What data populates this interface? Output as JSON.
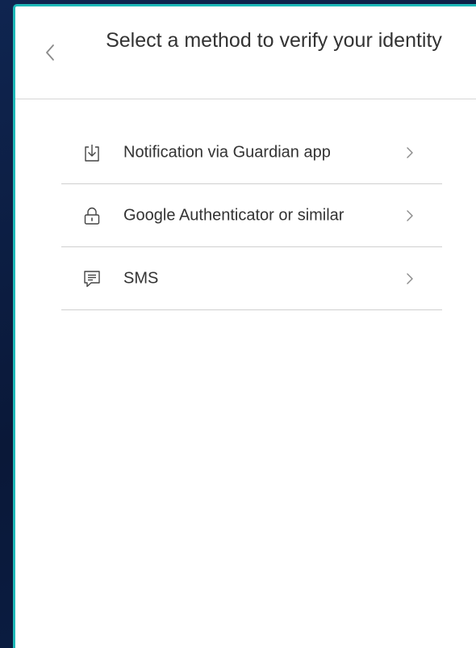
{
  "header": {
    "title": "Select a method to verify your identity"
  },
  "methods": [
    {
      "label": "Notification via Guardian app",
      "icon": "download-icon"
    },
    {
      "label": "Google Authenticator or similar",
      "icon": "lock-icon"
    },
    {
      "label": "SMS",
      "icon": "message-icon"
    }
  ],
  "colors": {
    "accent_border": "#1eb8b8",
    "background": "#0b1a3a",
    "text": "#333333",
    "divider": "#cfcfcf"
  }
}
